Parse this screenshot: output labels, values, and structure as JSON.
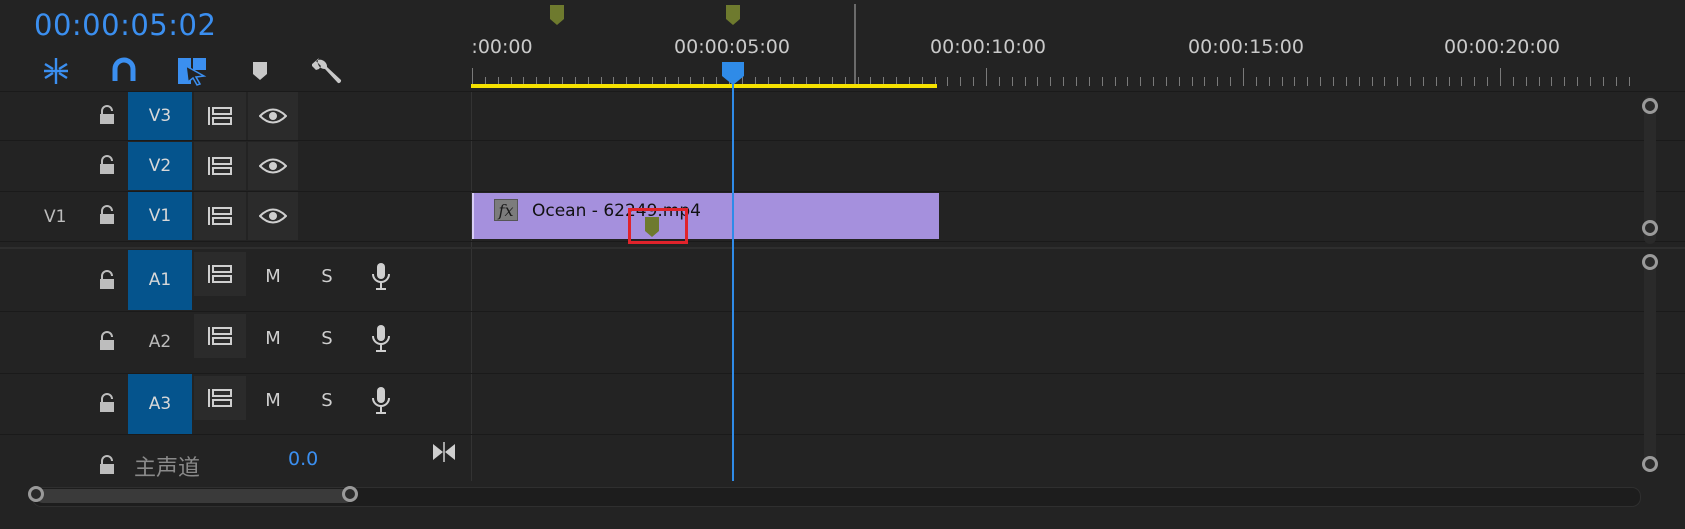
{
  "header": {
    "timecode": "00:00:05:02",
    "tools": [
      {
        "name": "insert-overwrite-sequences-icon"
      },
      {
        "name": "snap-icon"
      },
      {
        "name": "linked-selection-icon"
      },
      {
        "name": "add-marker-icon"
      },
      {
        "name": "timeline-settings-icon"
      }
    ]
  },
  "ruler": {
    "labels": [
      ":00:00",
      "00:00:05:00",
      "00:00:10:00",
      "00:00:15:00",
      "00:00:20:00"
    ]
  },
  "tracks": {
    "video": [
      {
        "target": "V3",
        "source": "",
        "target_on": true
      },
      {
        "target": "V2",
        "source": "",
        "target_on": true
      },
      {
        "target": "V1",
        "source": "V1",
        "target_on": true
      }
    ],
    "audio": [
      {
        "target": "A1",
        "target_on": true,
        "mute": "M",
        "solo": "S"
      },
      {
        "target": "A2",
        "target_on": false,
        "mute": "M",
        "solo": "S"
      },
      {
        "target": "A3",
        "target_on": true,
        "mute": "M",
        "solo": "S"
      }
    ],
    "master": {
      "label": "主声道",
      "value": "0.0"
    }
  },
  "clip": {
    "fx": "fx",
    "name": "Ocean - 62249.mp4"
  },
  "colors": {
    "accent": "#3b8ff0",
    "track_target": "#05548d",
    "clip": "#a590dd",
    "work_area": "#f5e100",
    "marker": "#6e7a2e",
    "highlight": "#e0232b"
  }
}
